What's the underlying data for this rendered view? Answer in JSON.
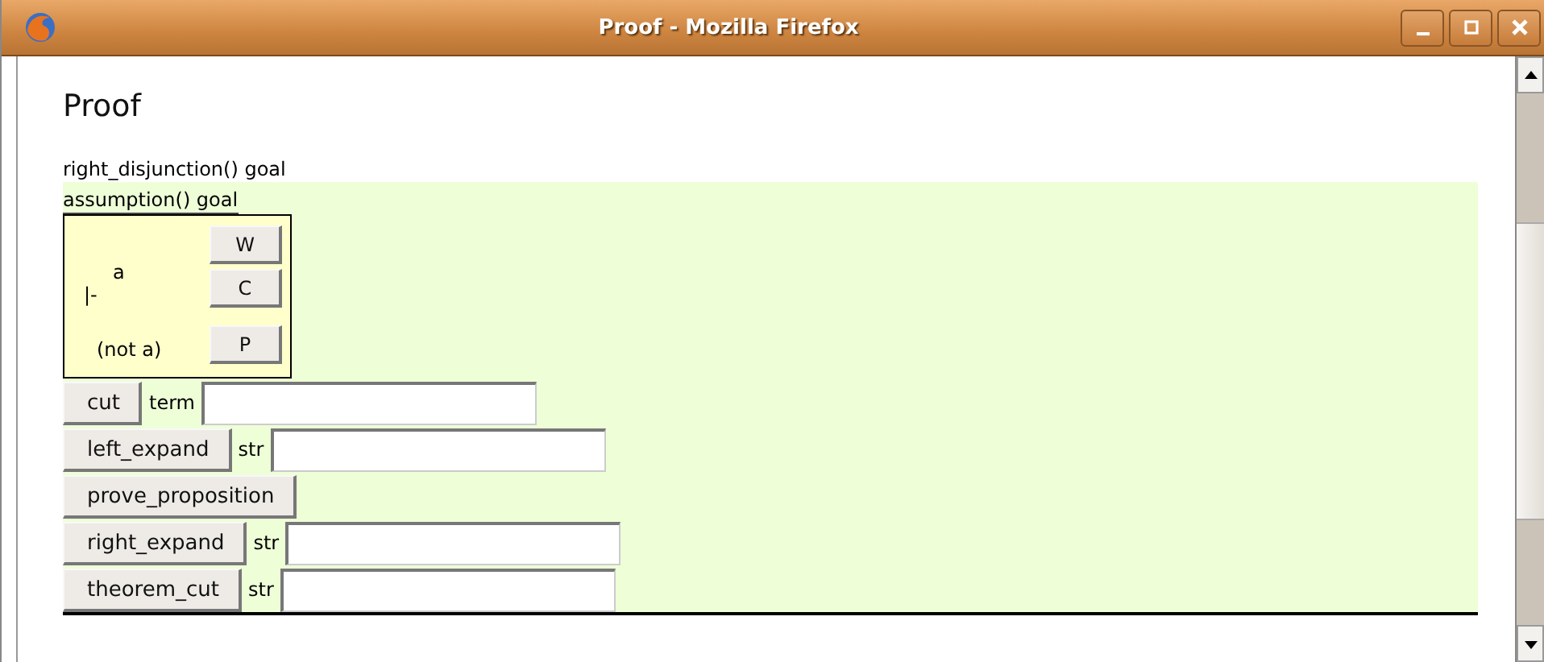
{
  "window": {
    "title": "Proof - Mozilla Firefox"
  },
  "heading": "Proof",
  "outer_goal": "right_disjunction() goal",
  "inner_goal": "assumption() goal",
  "sequent": {
    "hypotheses": [
      "a"
    ],
    "turnstile": "|-",
    "conclusions": [
      "(not a)"
    ],
    "buttons": [
      "W",
      "C",
      "P"
    ]
  },
  "actions": [
    {
      "label": "cut",
      "param": "term"
    },
    {
      "label": "left_expand",
      "param": "str"
    },
    {
      "label": "prove_proposition"
    },
    {
      "label": "right_expand",
      "param": "str"
    },
    {
      "label": "theorem_cut",
      "param": "str"
    }
  ]
}
